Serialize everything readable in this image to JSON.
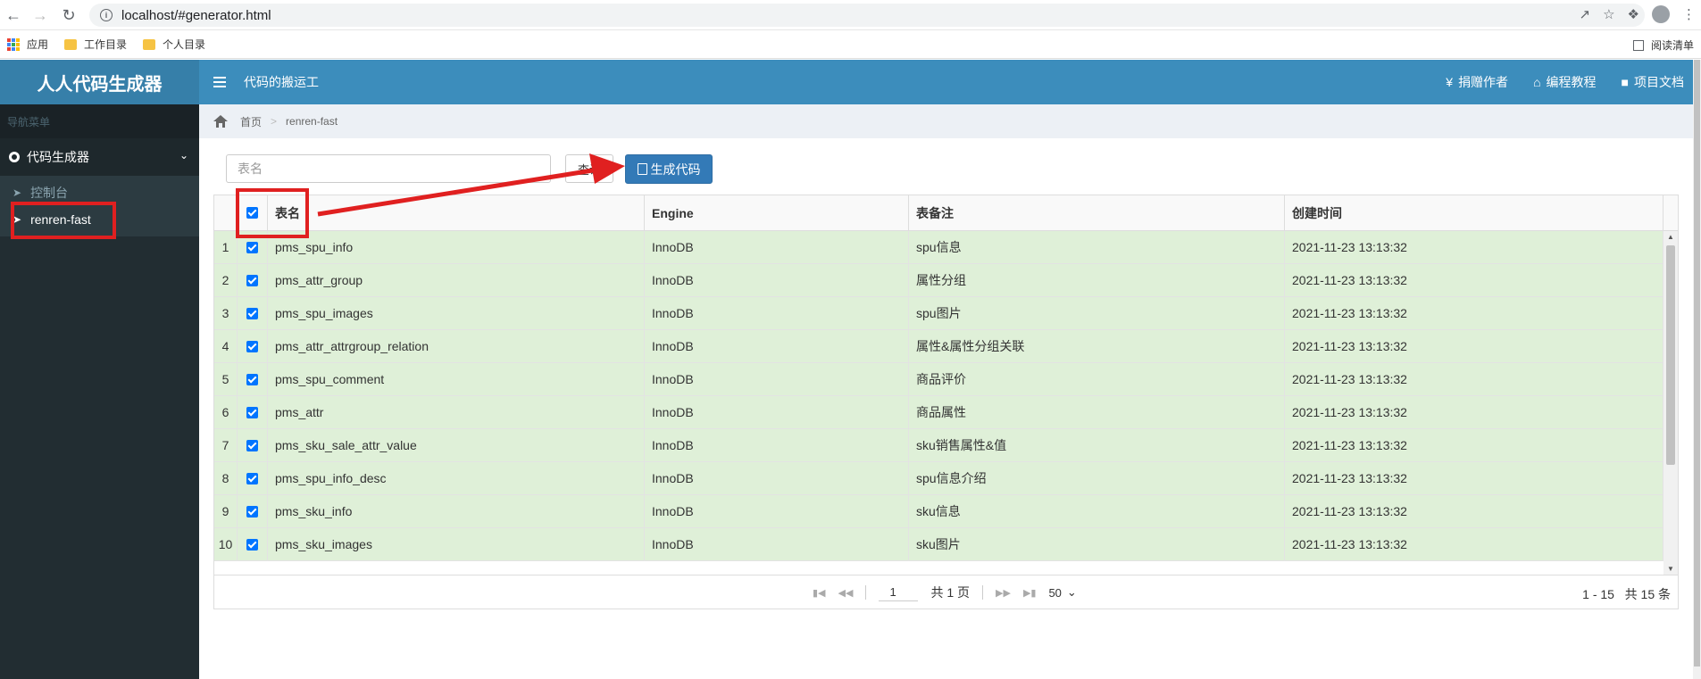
{
  "browser": {
    "url": "localhost/#generator.html",
    "bookmarks": [
      {
        "label": "应用",
        "icon": "apps-grid-icon"
      },
      {
        "label": "工作目录",
        "icon": "folder-icon"
      },
      {
        "label": "个人目录",
        "icon": "folder-icon"
      }
    ],
    "reading_list": "阅读清单"
  },
  "app": {
    "logo": "人人代码生成器",
    "header_title": "代码的搬运工",
    "header_links": [
      {
        "label": "捐赠作者",
        "icon": "yen-icon"
      },
      {
        "label": "编程教程",
        "icon": "home-icon"
      },
      {
        "label": "项目文档",
        "icon": "lock-icon"
      }
    ]
  },
  "sidebar": {
    "header": "导航菜单",
    "group": "代码生成器",
    "items": [
      {
        "label": "控制台"
      },
      {
        "label": "renren-fast"
      }
    ]
  },
  "breadcrumb": {
    "home": "首页",
    "current": "renren-fast"
  },
  "search": {
    "placeholder": "表名",
    "query_button": "查询",
    "generate_button": "生成代码"
  },
  "table": {
    "columns": {
      "name": "表名",
      "engine": "Engine",
      "comment": "表备注",
      "created": "创建时间"
    },
    "rows": [
      {
        "n": "1",
        "name": "pms_spu_info",
        "engine": "InnoDB",
        "comment": "spu信息",
        "created": "2021-11-23 13:13:32"
      },
      {
        "n": "2",
        "name": "pms_attr_group",
        "engine": "InnoDB",
        "comment": "属性分组",
        "created": "2021-11-23 13:13:32"
      },
      {
        "n": "3",
        "name": "pms_spu_images",
        "engine": "InnoDB",
        "comment": "spu图片",
        "created": "2021-11-23 13:13:32"
      },
      {
        "n": "4",
        "name": "pms_attr_attrgroup_relation",
        "engine": "InnoDB",
        "comment": "属性&属性分组关联",
        "created": "2021-11-23 13:13:32"
      },
      {
        "n": "5",
        "name": "pms_spu_comment",
        "engine": "InnoDB",
        "comment": "商品评价",
        "created": "2021-11-23 13:13:32"
      },
      {
        "n": "6",
        "name": "pms_attr",
        "engine": "InnoDB",
        "comment": "商品属性",
        "created": "2021-11-23 13:13:32"
      },
      {
        "n": "7",
        "name": "pms_sku_sale_attr_value",
        "engine": "InnoDB",
        "comment": "sku销售属性&值",
        "created": "2021-11-23 13:13:32"
      },
      {
        "n": "8",
        "name": "pms_spu_info_desc",
        "engine": "InnoDB",
        "comment": "spu信息介绍",
        "created": "2021-11-23 13:13:32"
      },
      {
        "n": "9",
        "name": "pms_sku_info",
        "engine": "InnoDB",
        "comment": "sku信息",
        "created": "2021-11-23 13:13:32"
      },
      {
        "n": "10",
        "name": "pms_sku_images",
        "engine": "InnoDB",
        "comment": "sku图片",
        "created": "2021-11-23 13:13:32"
      }
    ]
  },
  "pager": {
    "page": "1",
    "total_pages": "共 1 页",
    "page_size": "50",
    "range": "1 - 15",
    "total": "共 15 条"
  },
  "colors": {
    "header_blue": "#3c8dbc",
    "logo_blue": "#367fa9",
    "sidebar_dark": "#222d32",
    "row_green": "#dff0d8",
    "annotation_red": "#e02020"
  }
}
